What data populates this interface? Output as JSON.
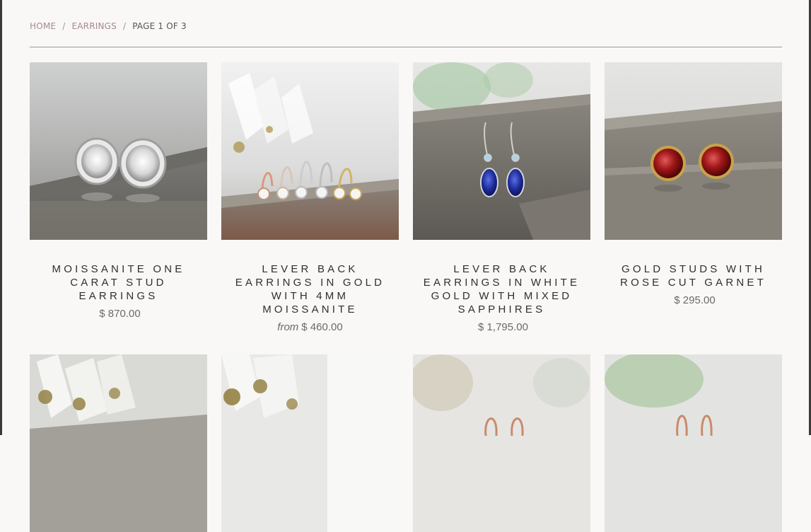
{
  "breadcrumb": {
    "home": "HOME",
    "separator": "/",
    "category": "EARRINGS",
    "current": "PAGE 1 OF 3"
  },
  "products": [
    {
      "title": "MOISSANITE ONE CARAT STUD EARRINGS",
      "price_prefix": "",
      "price": "$ 870.00",
      "image": "moissanite-bezel-studs-photo"
    },
    {
      "title": "LEVER BACK EARRINGS IN GOLD WITH 4MM MOISSANITE",
      "price_prefix": "from",
      "price": "$ 460.00",
      "image": "lever-back-gold-earrings-photo"
    },
    {
      "title": "LEVER BACK EARRINGS IN WHITE GOLD WITH MIXED SAPPHIRES",
      "price_prefix": "",
      "price": "$ 1,795.00",
      "image": "sapphire-lever-back-earrings-photo"
    },
    {
      "title": "GOLD STUDS WITH ROSE CUT GARNET",
      "price_prefix": "",
      "price": "$ 295.00",
      "image": "garnet-gold-studs-photo"
    }
  ],
  "second_row": [
    {
      "image": "crystal-pyrite-earrings-photo"
    },
    {
      "image": "crystal-pyrite-earrings-photo-2"
    },
    {
      "image": "rose-gold-lever-back-photo"
    },
    {
      "image": "rose-gold-lever-back-photo-2"
    }
  ],
  "colors": {
    "background": "#f9f8f7",
    "link": "#a58a8a",
    "text": "#2f2f2f",
    "price": "#6a6a6a"
  }
}
